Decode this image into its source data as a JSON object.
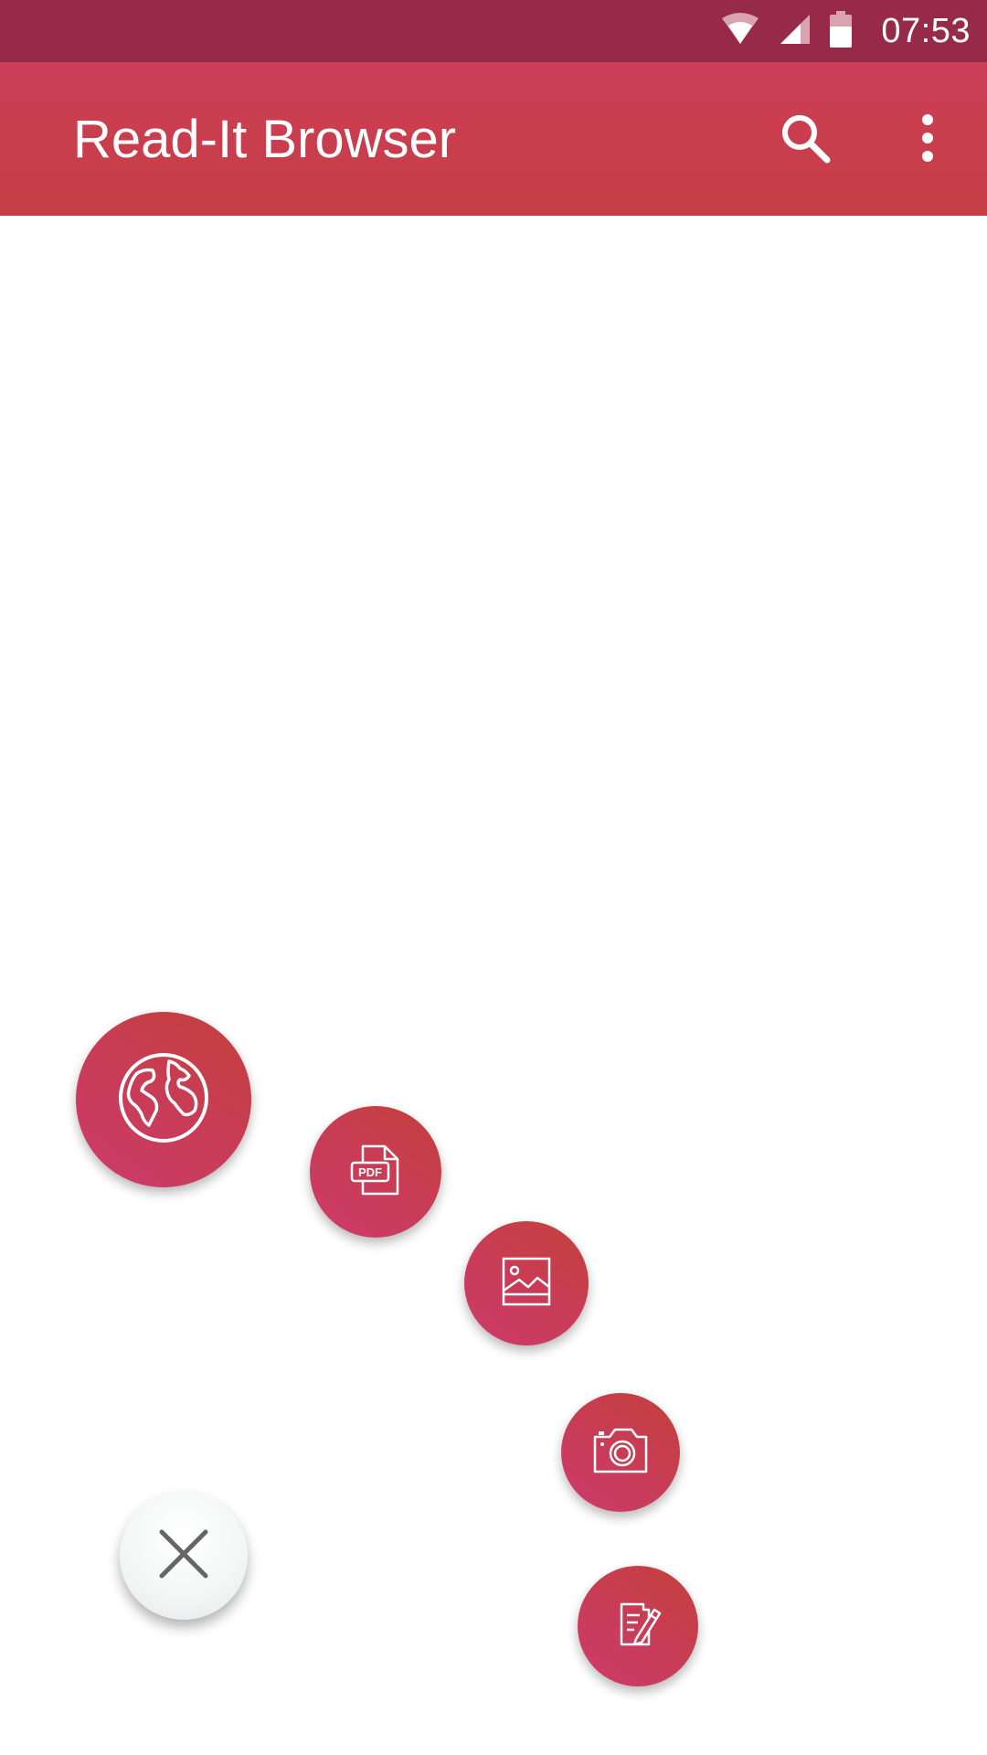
{
  "status_bar": {
    "time": "07:53",
    "icons": [
      "wifi-icon",
      "cell-signal-icon",
      "battery-icon"
    ]
  },
  "app_bar": {
    "title": "Read-It Browser",
    "actions": [
      {
        "name": "search",
        "icon": "search-icon"
      },
      {
        "name": "more-options",
        "icon": "more-vert-icon"
      }
    ]
  },
  "fab_menu": {
    "items": [
      {
        "name": "browse-web",
        "icon": "globe-icon"
      },
      {
        "name": "open-pdf",
        "icon": "pdf-file-icon",
        "icon_text": "PDF"
      },
      {
        "name": "open-image",
        "icon": "image-icon"
      },
      {
        "name": "camera",
        "icon": "camera-icon"
      },
      {
        "name": "write-note",
        "icon": "note-edit-icon"
      }
    ],
    "close": {
      "icon": "close-icon"
    }
  },
  "colors": {
    "status_bar": "#962a48",
    "app_bar": "#c93f50",
    "fab": "#c93c55",
    "fab_close": "#f3f5f5",
    "icon_close": "#666666"
  }
}
